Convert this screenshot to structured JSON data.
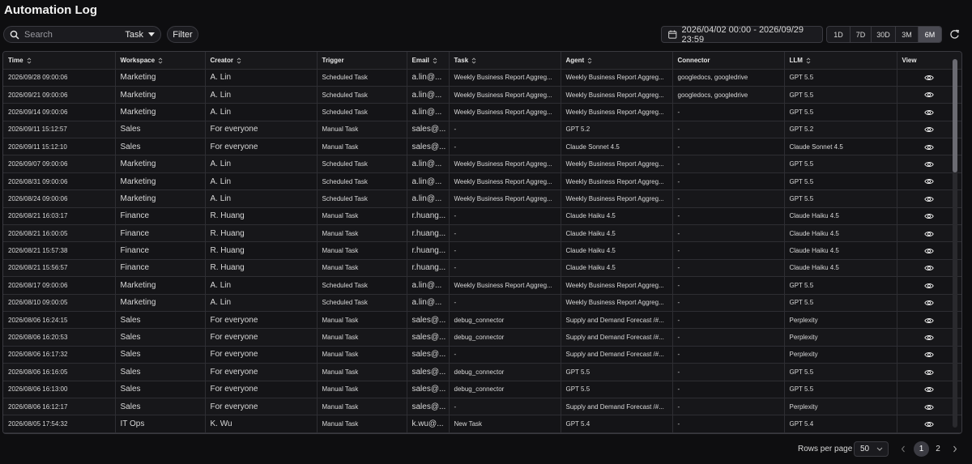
{
  "page": {
    "title": "Automation Log"
  },
  "toolbar": {
    "search_placeholder": "Search",
    "search_type": "Task",
    "filter_label": "Filter",
    "date_range": "2026/04/02 00:00 - 2026/09/29 23:59",
    "ranges": [
      "1D",
      "7D",
      "30D",
      "3M",
      "6M"
    ],
    "active_range": "6M"
  },
  "table": {
    "columns": [
      "Time",
      "Workspace",
      "Creator",
      "Trigger",
      "Email",
      "Task",
      "Agent",
      "Connector",
      "LLM",
      "View"
    ],
    "rows": [
      [
        "2026/09/28 09:00:06",
        "Marketing",
        "A. Lin",
        "Scheduled Task",
        "a.lin@...",
        "Weekly Business Report Aggreg...",
        "Weekly Business Report Aggreg...",
        "googledocs, googledrive",
        "GPT 5.5"
      ],
      [
        "2026/09/21 09:00:06",
        "Marketing",
        "A. Lin",
        "Scheduled Task",
        "a.lin@...",
        "Weekly Business Report Aggreg...",
        "Weekly Business Report Aggreg...",
        "googledocs, googledrive",
        "GPT 5.5"
      ],
      [
        "2026/09/14 09:00:06",
        "Marketing",
        "A. Lin",
        "Scheduled Task",
        "a.lin@...",
        "Weekly Business Report Aggreg...",
        "Weekly Business Report Aggreg...",
        "-",
        "GPT 5.5"
      ],
      [
        "2026/09/11 15:12:57",
        "Sales",
        "For everyone",
        "Manual Task",
        "sales@...",
        "-",
        "GPT 5.2",
        "-",
        "GPT 5.2"
      ],
      [
        "2026/09/11 15:12:10",
        "Sales",
        "For everyone",
        "Manual Task",
        "sales@...",
        "-",
        "Claude Sonnet 4.5",
        "-",
        "Claude Sonnet 4.5"
      ],
      [
        "2026/09/07 09:00:06",
        "Marketing",
        "A. Lin",
        "Scheduled Task",
        "a.lin@...",
        "Weekly Business Report Aggreg...",
        "Weekly Business Report Aggreg...",
        "-",
        "GPT 5.5"
      ],
      [
        "2026/08/31 09:00:06",
        "Marketing",
        "A. Lin",
        "Scheduled Task",
        "a.lin@...",
        "Weekly Business Report Aggreg...",
        "Weekly Business Report Aggreg...",
        "-",
        "GPT 5.5"
      ],
      [
        "2026/08/24 09:00:06",
        "Marketing",
        "A. Lin",
        "Scheduled Task",
        "a.lin@...",
        "Weekly Business Report Aggreg...",
        "Weekly Business Report Aggreg...",
        "-",
        "GPT 5.5"
      ],
      [
        "2026/08/21 16:03:17",
        "Finance",
        "R. Huang",
        "Manual Task",
        "r.huang...",
        "-",
        "Claude Haiku 4.5",
        "-",
        "Claude Haiku 4.5"
      ],
      [
        "2026/08/21 16:00:05",
        "Finance",
        "R. Huang",
        "Manual Task",
        "r.huang...",
        "-",
        "Claude Haiku 4.5",
        "-",
        "Claude Haiku 4.5"
      ],
      [
        "2026/08/21 15:57:38",
        "Finance",
        "R. Huang",
        "Manual Task",
        "r.huang...",
        "-",
        "Claude Haiku 4.5",
        "-",
        "Claude Haiku 4.5"
      ],
      [
        "2026/08/21 15:56:57",
        "Finance",
        "R. Huang",
        "Manual Task",
        "r.huang...",
        "-",
        "Claude Haiku 4.5",
        "-",
        "Claude Haiku 4.5"
      ],
      [
        "2026/08/17 09:00:06",
        "Marketing",
        "A. Lin",
        "Scheduled Task",
        "a.lin@...",
        "Weekly Business Report Aggreg...",
        "Weekly Business Report Aggreg...",
        "-",
        "GPT 5.5"
      ],
      [
        "2026/08/10 09:00:05",
        "Marketing",
        "A. Lin",
        "Scheduled Task",
        "a.lin@...",
        "-",
        "Weekly Business Report Aggreg...",
        "-",
        "GPT 5.5"
      ],
      [
        "2026/08/06 16:24:15",
        "Sales",
        "For everyone",
        "Manual Task",
        "sales@...",
        "debug_connector",
        "Supply and Demand Forecast /#...",
        "-",
        "Perplexity"
      ],
      [
        "2026/08/06 16:20:53",
        "Sales",
        "For everyone",
        "Manual Task",
        "sales@...",
        "debug_connector",
        "Supply and Demand Forecast /#...",
        "-",
        "Perplexity"
      ],
      [
        "2026/08/06 16:17:32",
        "Sales",
        "For everyone",
        "Manual Task",
        "sales@...",
        "-",
        "Supply and Demand Forecast /#...",
        "-",
        "Perplexity"
      ],
      [
        "2026/08/06 16:16:05",
        "Sales",
        "For everyone",
        "Manual Task",
        "sales@...",
        "debug_connector",
        "GPT 5.5",
        "-",
        "GPT 5.5"
      ],
      [
        "2026/08/06 16:13:00",
        "Sales",
        "For everyone",
        "Manual Task",
        "sales@...",
        "debug_connector",
        "GPT 5.5",
        "-",
        "GPT 5.5"
      ],
      [
        "2026/08/06 16:12:17",
        "Sales",
        "For everyone",
        "Manual Task",
        "sales@...",
        "-",
        "Supply and Demand Forecast /#...",
        "-",
        "Perplexity"
      ],
      [
        "2026/08/05 17:54:32",
        "IT Ops",
        "K. Wu",
        "Manual Task",
        "k.wu@...",
        "New Task",
        "GPT 5.4",
        "-",
        "GPT 5.4"
      ]
    ]
  },
  "footer": {
    "rows_per_page_label": "Rows per page",
    "rows_per_page": "50",
    "pages": [
      "1",
      "2"
    ],
    "current_page": "1"
  },
  "colors": {
    "background": "#0e0e10",
    "table_bg": "#141417",
    "border": "#3a3a40",
    "active_pill": "#4a4a52"
  }
}
